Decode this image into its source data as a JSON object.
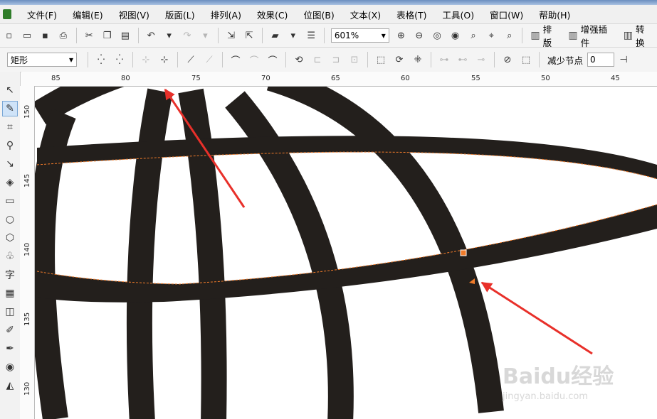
{
  "window": {
    "title": ""
  },
  "menu": [
    "文件(F)",
    "编辑(E)",
    "视图(V)",
    "版面(L)",
    "排列(A)",
    "效果(C)",
    "位图(B)",
    "文本(X)",
    "表格(T)",
    "工具(O)",
    "窗口(W)",
    "帮助(H)"
  ],
  "toolbar": {
    "zoom_value": "601%",
    "plugins": [
      "排版",
      "增强插件",
      "转换"
    ]
  },
  "property_bar": {
    "shape_value": "矩形",
    "reduce_nodes_label": "减少节点",
    "reduce_nodes_value": "0"
  },
  "rulers": {
    "horizontal": [
      "85",
      "80",
      "75",
      "70",
      "65",
      "60",
      "55",
      "50",
      "45"
    ],
    "vertical": [
      "150",
      "145",
      "140",
      "135",
      "130"
    ]
  },
  "watermark": {
    "main": "Baidu经验",
    "sub": "jingyan.baidu.com"
  },
  "colors": {
    "shape_fill": "#231f1c",
    "arrow": "#e8302a",
    "node": "#f07b2a"
  }
}
